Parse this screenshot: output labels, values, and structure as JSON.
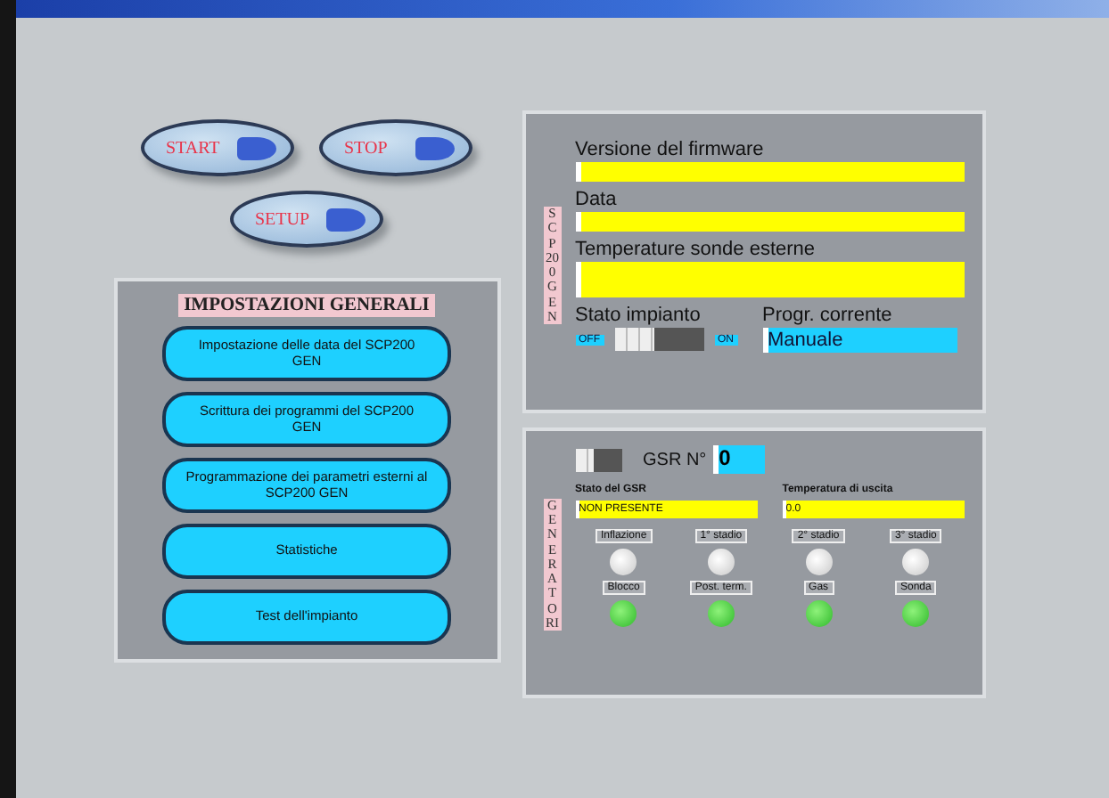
{
  "top_buttons": [
    {
      "label": "START"
    },
    {
      "label": "STOP"
    },
    {
      "label": "SETUP"
    }
  ],
  "general_settings": {
    "title": "IMPOSTAZIONI GENERALI",
    "buttons": [
      "Impostazione delle data del SCP200 GEN",
      "Scrittura dei programmi del SCP200 GEN",
      "Programmazione dei parametri esterni al SCP200 GEN",
      "Statistiche",
      "Test dell'impianto"
    ]
  },
  "device_panel": {
    "side_label": "SCP200 GEN",
    "fields": [
      {
        "label": "Versione del firmware",
        "kind": "line"
      },
      {
        "label": "Data",
        "kind": "line"
      },
      {
        "label": "Temperature sonde esterne",
        "kind": "tall"
      }
    ],
    "plant_state": {
      "label": "Stato impianto",
      "off_label": "OFF",
      "on_label": "ON",
      "on": false
    },
    "program": {
      "label": "Progr. corrente",
      "value": "Manuale"
    }
  },
  "generator_panel": {
    "side_label": "GENERATORI",
    "toggle_on": false,
    "gsr_label": "GSR N°",
    "gsr_value": "0",
    "state": {
      "label": "Stato del GSR",
      "value": "NON PRESENTE"
    },
    "temperature": {
      "label": "Temperatura di uscita",
      "value": "0.0"
    },
    "lamps": [
      {
        "label": "Inflazione",
        "lit": false
      },
      {
        "label": "1° stadio",
        "lit": false
      },
      {
        "label": "2° stadio",
        "lit": false
      },
      {
        "label": "3° stadio",
        "lit": false
      },
      {
        "label": "Blocco",
        "lit": true
      },
      {
        "label": "Post. term.",
        "lit": true
      },
      {
        "label": "Gas",
        "lit": true
      },
      {
        "label": "Sonda",
        "lit": true
      }
    ]
  }
}
